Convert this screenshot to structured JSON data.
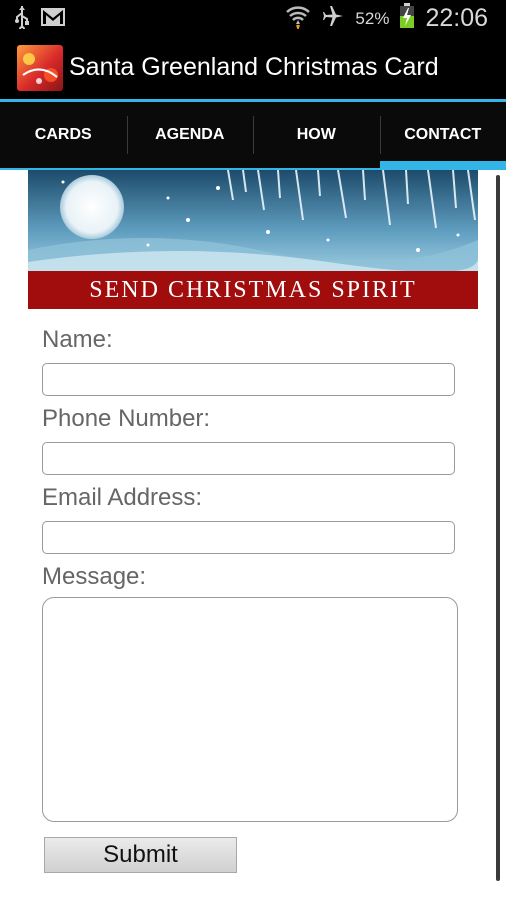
{
  "status_bar": {
    "icons": [
      "usb-icon",
      "gmail-icon",
      "wifi-icon",
      "airplane-mode-icon",
      "battery-icon"
    ],
    "battery_percent": "52%",
    "time": "22:06"
  },
  "app_bar": {
    "title": "Santa Greenland Christmas Card"
  },
  "tabs": [
    {
      "label": "CARDS"
    },
    {
      "label": "AGENDA"
    },
    {
      "label": "HOW"
    },
    {
      "label": "CONTACT"
    }
  ],
  "active_tab": "CONTACT",
  "banner": {
    "text": "SEND CHRISTMAS SPIRIT"
  },
  "form": {
    "name_label": "Name:",
    "phone_label": "Phone Number:",
    "email_label": "Email Address:",
    "message_label": "Message:",
    "name_value": "",
    "phone_value": "",
    "email_value": "",
    "message_value": "",
    "submit_label": "Submit"
  },
  "colors": {
    "accent": "#33b5e5",
    "banner_red": "#a10c0c"
  }
}
